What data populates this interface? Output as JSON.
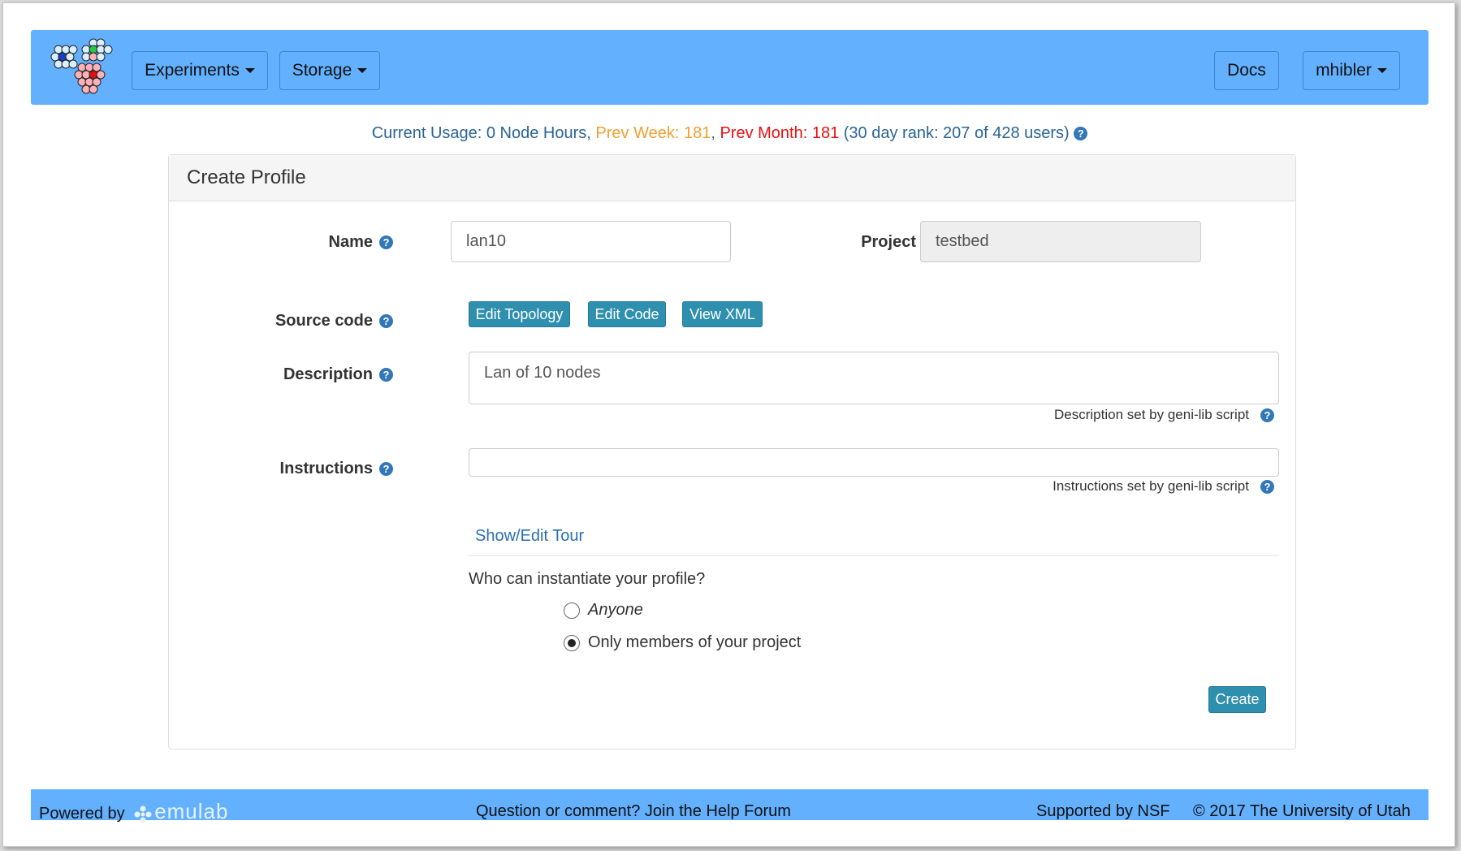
{
  "nav": {
    "experiments_label": "Experiments",
    "storage_label": "Storage",
    "docs_label": "Docs",
    "user_label": "mhibler"
  },
  "usage": {
    "current": "Current Usage: 0 Node Hours",
    "sep1": ", ",
    "prev_week": "Prev Week: 181",
    "sep2": ", ",
    "prev_month": "Prev Month: 181",
    "rank": " (30 day rank: 207 of 428 users) "
  },
  "panel": {
    "title": "Create Profile",
    "name_label": "Name",
    "name_value": "lan10",
    "project_label": "Project",
    "project_value": "testbed",
    "source_label": "Source code",
    "edit_topology": "Edit Topology",
    "edit_code": "Edit Code",
    "view_xml": "View XML",
    "description_label": "Description",
    "description_value": "Lan of 10 nodes",
    "description_hint": "Description set by geni-lib script",
    "instructions_label": "Instructions",
    "instructions_value": "",
    "instructions_hint": "Instructions set by geni-lib script",
    "tour_link": "Show/Edit Tour",
    "question": "Who can instantiate your profile?",
    "option_anyone": "Anyone",
    "option_members": "Only members of your project",
    "selected_option": "members",
    "create_label": "Create"
  },
  "footer": {
    "powered_by": "Powered by",
    "emulab": "emulab",
    "help": "Question or comment? Join the Help Forum",
    "nsf": "Supported by NSF",
    "copyright": "© 2017 The University of Utah"
  },
  "colors": {
    "navbar": "#63b0ff",
    "button_teal": "#2f8fae",
    "link": "#2a6fb3",
    "usage": "#2a6496",
    "prev_week": "#f0a030",
    "prev_month": "#e81010"
  },
  "icons": [
    "logo-icon",
    "help-icon",
    "caret-down-icon",
    "emulab-flower-icon"
  ]
}
